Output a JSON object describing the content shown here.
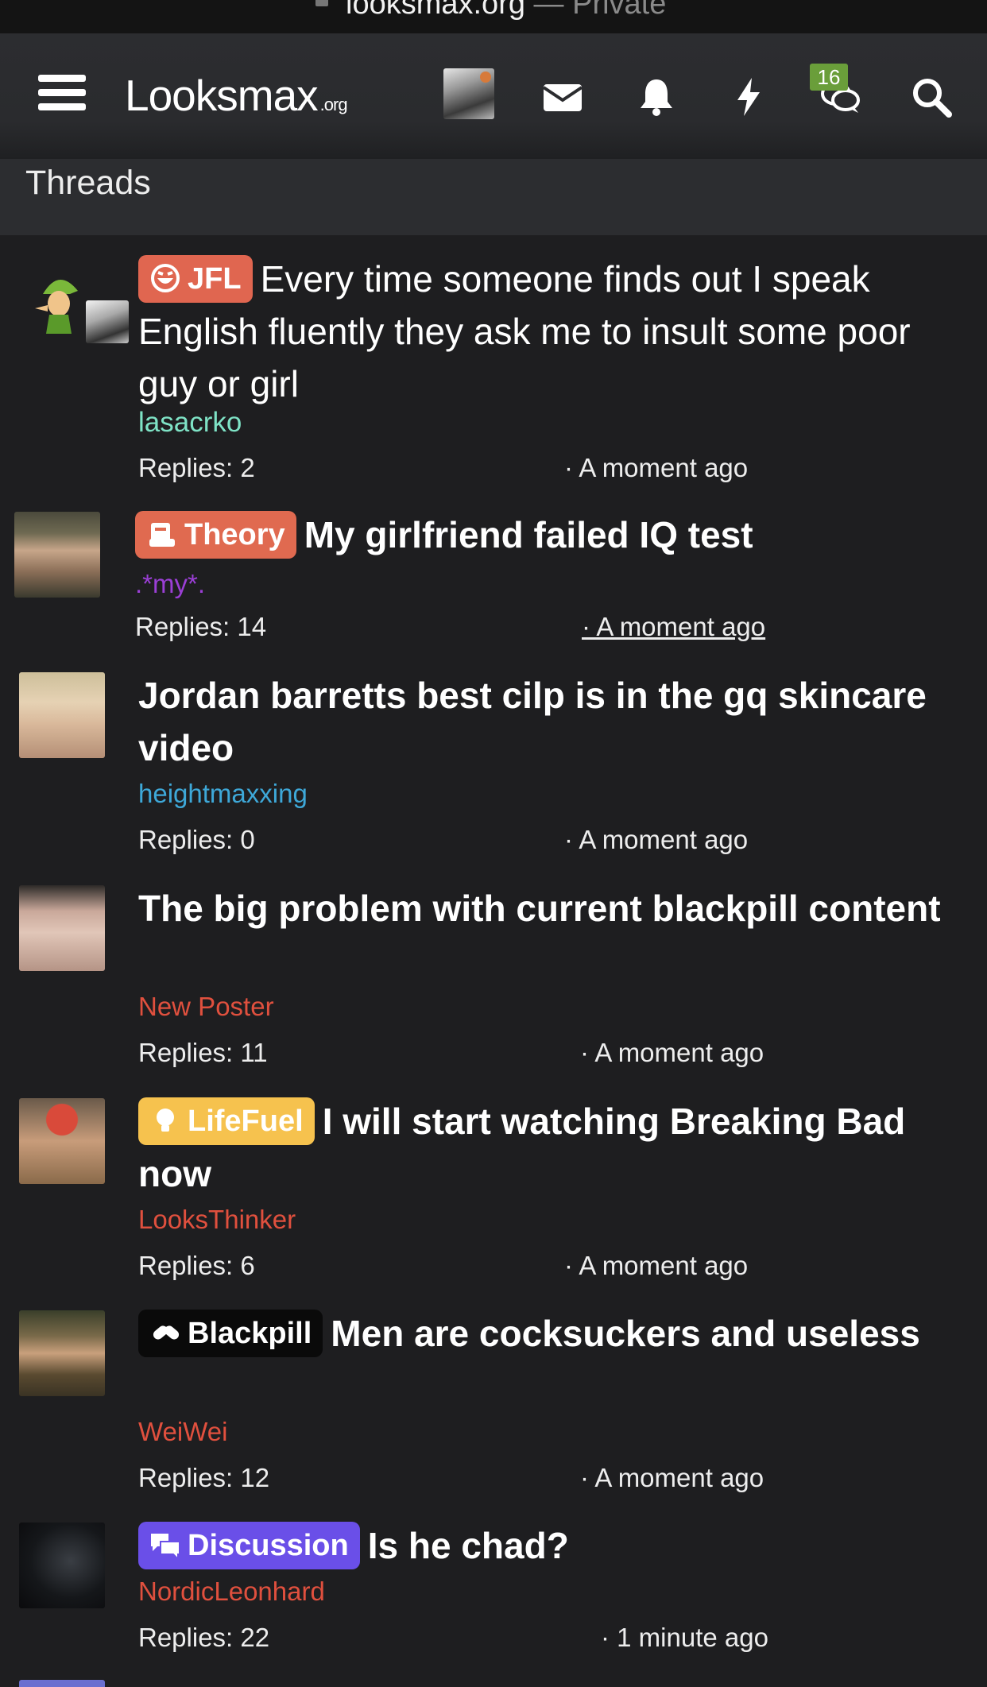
{
  "browser": {
    "url": "looksmax.org",
    "privacy": "— Private"
  },
  "nav": {
    "logo_main": "Looksmax",
    "logo_suffix": ".org",
    "conversations_badge": "16",
    "icons": [
      "menu-icon",
      "avatar",
      "envelope-icon",
      "bell-icon",
      "lightning-icon",
      "chat-bubbles-icon",
      "search-icon"
    ]
  },
  "section": {
    "title": "Threads"
  },
  "threads": [
    {
      "prefix": "JFL",
      "prefix_color": "#e06650",
      "title": "Every time someone finds out I speak English fluently they ask me to insult some poor guy or girl",
      "author": "lasacrko",
      "author_color": "#7fe3c6",
      "replies": "Replies: 2",
      "time": "· A moment ago"
    },
    {
      "prefix": "Theory",
      "prefix_color": "#e06a50",
      "title": "My girlfriend failed IQ test",
      "author": ".*my*.",
      "author_color": "#9b3fd6",
      "replies": "Replies: 14",
      "time": "· A moment ago"
    },
    {
      "prefix": "",
      "prefix_color": "",
      "title": "Jordan barretts best cilp is in the gq skincare video",
      "author": "heightmaxxing",
      "author_color": "#3ea8d8",
      "replies": "Replies: 0",
      "time": "· A moment ago"
    },
    {
      "prefix": "",
      "prefix_color": "",
      "title": "The big problem with current blackpill content",
      "author": "New Poster",
      "author_color": "#e0503e",
      "replies": "Replies: 11",
      "time": "· A moment ago"
    },
    {
      "prefix": "LifeFuel",
      "prefix_color": "#f6c24e",
      "title": "I will start watching Breaking Bad now",
      "author": "LooksThinker",
      "author_color": "#e0503e",
      "replies": "Replies: 6",
      "time": "· A moment ago"
    },
    {
      "prefix": "Blackpill",
      "prefix_color": "#0a0a0a",
      "title": "Men are cocksuckers and useless",
      "author": "WeiWei",
      "author_color": "#e0503e",
      "replies": "Replies: 12",
      "time": "· A moment ago"
    },
    {
      "prefix": "Discussion",
      "prefix_color": "#6a4fe8",
      "title": "Is he chad?",
      "author": "NordicLeonhard",
      "author_color": "#e0503e",
      "replies": "Replies: 22",
      "time": "· 1 minute ago"
    }
  ]
}
